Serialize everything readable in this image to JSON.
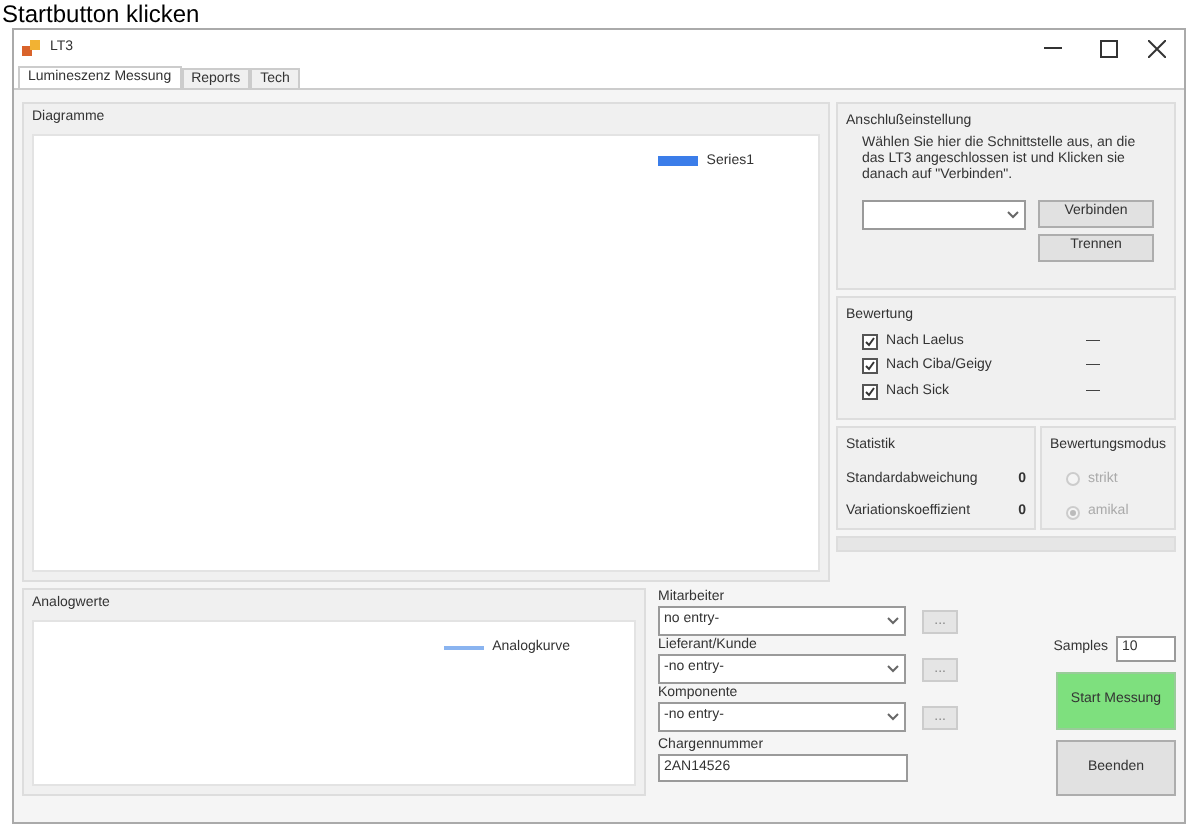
{
  "caption": "Startbutton klicken",
  "window": {
    "title": "LT3"
  },
  "tabs": [
    {
      "label": "Lumineszenz Messung",
      "selected": true
    },
    {
      "label": "Reports",
      "selected": false
    },
    {
      "label": "Tech",
      "selected": false
    }
  ],
  "diagram": {
    "title": "Diagramme",
    "legend": [
      {
        "name": "Series1",
        "color": "#3b7de9"
      }
    ]
  },
  "connection": {
    "title": "Anschlußeinstellung",
    "hint": "Wählen Sie hier die Schnittstelle aus, an die das LT3 angeschlossen ist und Klicken sie danach auf \"Verbinden\".",
    "buttons": [
      "Verbinden",
      "Trennen"
    ]
  },
  "rating": {
    "title": "Bewertung",
    "items": [
      {
        "label": "Nach Laelus",
        "checked": true,
        "value": "—"
      },
      {
        "label": "Nach Ciba/Geigy",
        "checked": true,
        "value": "—"
      },
      {
        "label": "Nach Sick",
        "checked": true,
        "value": "—"
      }
    ]
  },
  "statistics": {
    "title": "Statistik",
    "rows": [
      {
        "label": "Standardabweichung",
        "value": "0"
      },
      {
        "label": "Variationskoeffizient",
        "value": "0"
      }
    ]
  },
  "mode": {
    "title": "Bewertungsmodus",
    "options": [
      {
        "label": "strikt",
        "selected": false,
        "disabled": true
      },
      {
        "label": "amikal",
        "selected": true,
        "disabled": true
      }
    ]
  },
  "analog": {
    "title": "Analogwerte",
    "legend": [
      {
        "name": "Analogkurve",
        "color": "#8ab4f0"
      }
    ]
  },
  "fields": [
    {
      "label": "Mitarbeiter",
      "value": "no entry-",
      "button": "..."
    },
    {
      "label": "Lieferant/Kunde",
      "value": "-no entry-",
      "button": "..."
    },
    {
      "label": "Komponente",
      "value": "-no entry-",
      "button": "..."
    }
  ],
  "batch": {
    "label": "Chargennummer",
    "value": "2AN14526"
  },
  "samples": {
    "label": "Samples",
    "value": "10"
  },
  "start_button": "Start Messung",
  "end_button": "Beenden"
}
